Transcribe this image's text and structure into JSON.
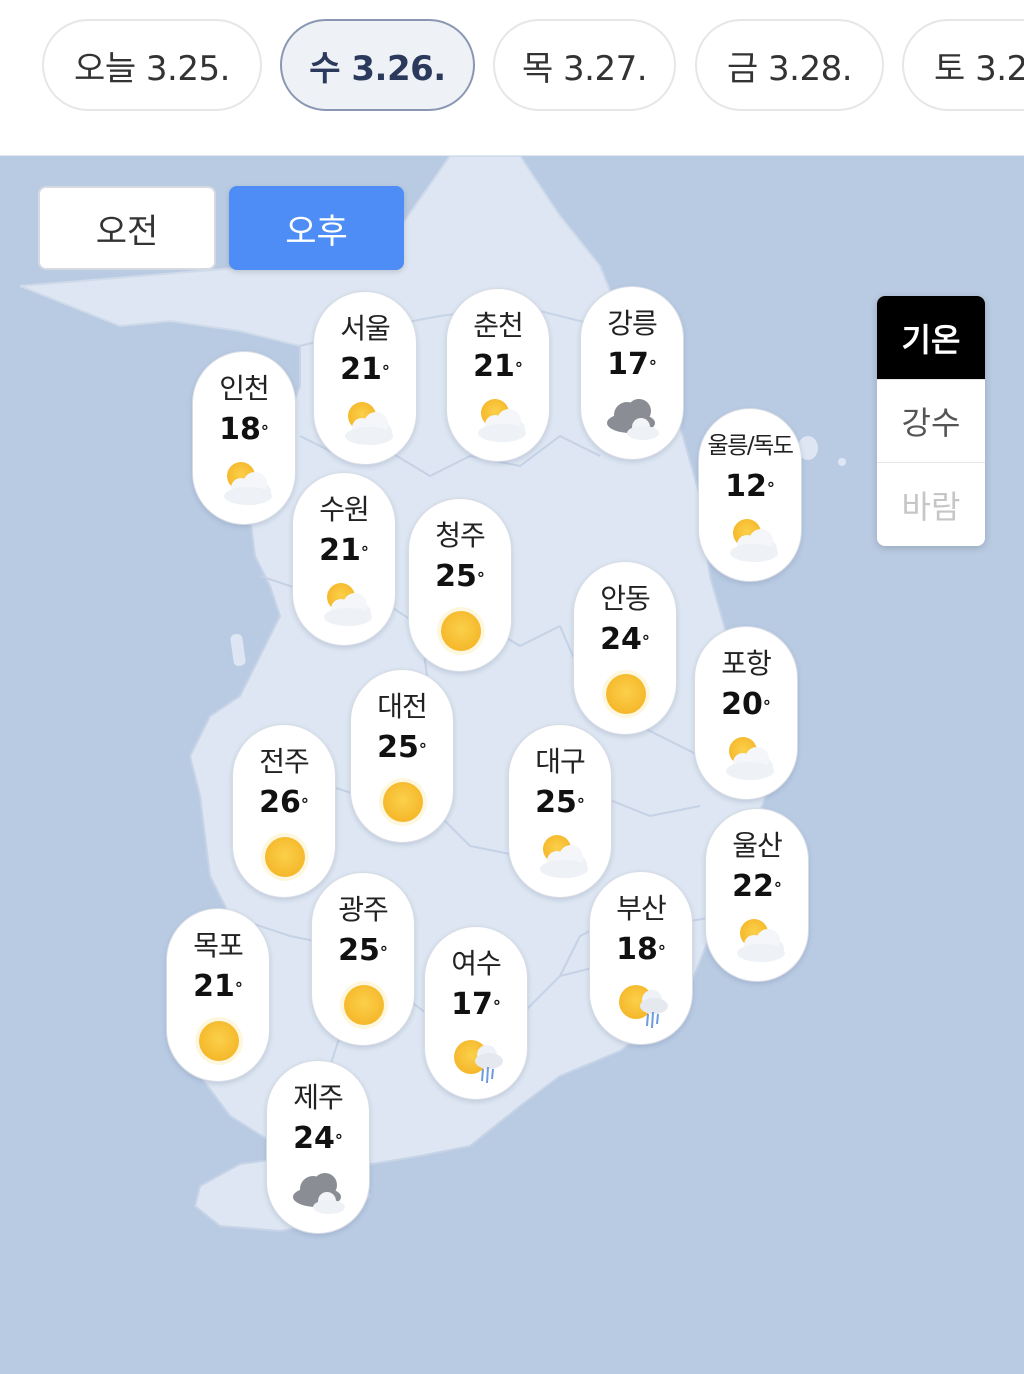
{
  "date_tabs": [
    {
      "label": "오늘 3.25.",
      "selected": false
    },
    {
      "label": "수 3.26.",
      "selected": true
    },
    {
      "label": "목 3.27.",
      "selected": false
    },
    {
      "label": "금 3.28.",
      "selected": false
    },
    {
      "label": "토 3.2",
      "selected": false
    }
  ],
  "time_toggle": {
    "am_label": "오전",
    "pm_label": "오후",
    "selected": "오후"
  },
  "layers": {
    "temperature": "기온",
    "precipitation": "강수",
    "wind": "바람",
    "selected": "기온"
  },
  "colors": {
    "accent_blue": "#4d8df5",
    "map_bg": "#b9cbe3",
    "land": "#dde6f2",
    "sun": "#f7c23a"
  },
  "cities": [
    {
      "name": "인천",
      "temp": "18",
      "icon": "partly-cloudy-icon"
    },
    {
      "name": "서울",
      "temp": "21",
      "icon": "partly-cloudy-icon"
    },
    {
      "name": "춘천",
      "temp": "21",
      "icon": "partly-cloudy-icon"
    },
    {
      "name": "강릉",
      "temp": "17",
      "icon": "cloudy-icon"
    },
    {
      "name": "울릉/독도",
      "temp": "12",
      "icon": "partly-cloudy-icon"
    },
    {
      "name": "수원",
      "temp": "21",
      "icon": "partly-cloudy-icon"
    },
    {
      "name": "청주",
      "temp": "25",
      "icon": "sun-icon"
    },
    {
      "name": "안동",
      "temp": "24",
      "icon": "sun-icon"
    },
    {
      "name": "포항",
      "temp": "20",
      "icon": "partly-cloudy-icon"
    },
    {
      "name": "대전",
      "temp": "25",
      "icon": "sun-icon"
    },
    {
      "name": "전주",
      "temp": "26",
      "icon": "sun-icon"
    },
    {
      "name": "대구",
      "temp": "25",
      "icon": "partly-cloudy-icon"
    },
    {
      "name": "울산",
      "temp": "22",
      "icon": "partly-cloudy-icon"
    },
    {
      "name": "광주",
      "temp": "25",
      "icon": "sun-icon"
    },
    {
      "name": "부산",
      "temp": "18",
      "icon": "sun-shower-icon"
    },
    {
      "name": "목포",
      "temp": "21",
      "icon": "sun-icon"
    },
    {
      "name": "여수",
      "temp": "17",
      "icon": "sun-shower-icon"
    },
    {
      "name": "제주",
      "temp": "24",
      "icon": "cloudy-icon"
    }
  ]
}
